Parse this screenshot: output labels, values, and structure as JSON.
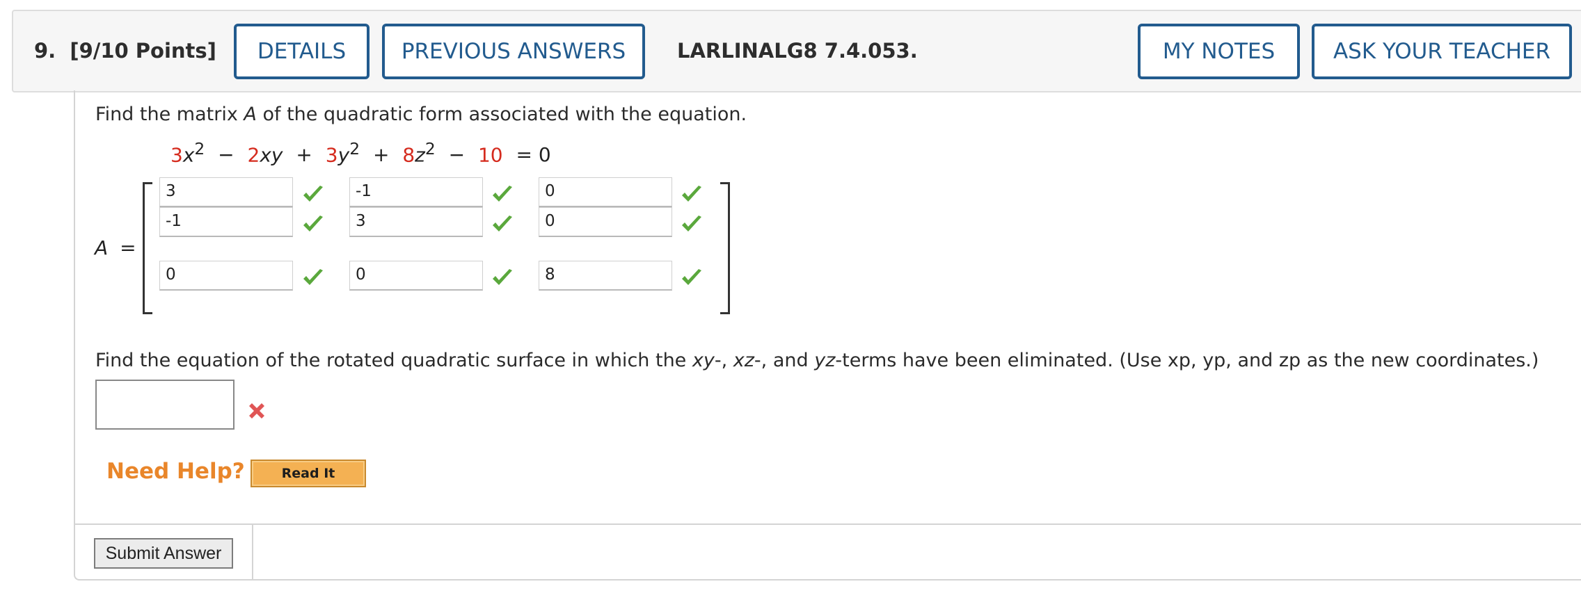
{
  "header": {
    "question_number": "9.",
    "points": "[9/10 Points]",
    "details_label": "DETAILS",
    "previous_answers_label": "PREVIOUS ANSWERS",
    "assignment_code": "LARLINALG8 7.4.053.",
    "my_notes_label": "MY NOTES",
    "ask_teacher_label": "ASK YOUR TEACHER"
  },
  "part1": {
    "prompt_before": "Find the matrix ",
    "prompt_var": "A",
    "prompt_after": " of the quadratic form associated with the equation.",
    "equation": {
      "c1": "3",
      "v1": "x",
      "e1": "2",
      "op1": "−",
      "c2": "2",
      "v2": "xy",
      "op2": "+",
      "c3": "3",
      "v3": "y",
      "e3": "2",
      "op3": "+",
      "c4": "8",
      "v4": "z",
      "e4": "2",
      "op4": "−",
      "c5": "10",
      "rhs": "= 0"
    },
    "matrix_label_var": "A",
    "matrix_label_eq": "=",
    "matrix": [
      [
        "3",
        "-1",
        "0"
      ],
      [
        "-1",
        "3",
        "0"
      ],
      [
        "0",
        "0",
        "8"
      ]
    ],
    "status_icon": "check-icon",
    "status_color": "#5aa83c"
  },
  "part2": {
    "prompt_a": "Find the equation of the rotated quadratic surface in which the ",
    "xy": "xy",
    "sep1": "-, ",
    "xz": "xz",
    "sep2": "-, and ",
    "yz": "yz",
    "prompt_b": "-terms have been eliminated. (Use xp, yp, and zp as the new coordinates.)",
    "answer_value": "",
    "status_icon": "x-mark-icon",
    "status_color": "#e05555"
  },
  "help": {
    "need_help": "Need Help?",
    "read_it": "Read It"
  },
  "submit_label": "Submit Answer",
  "colors": {
    "accent": "#225b8e",
    "coefficient_red": "#d52b1e",
    "help_orange": "#e9862a",
    "read_it_bg": "#f4b153"
  }
}
